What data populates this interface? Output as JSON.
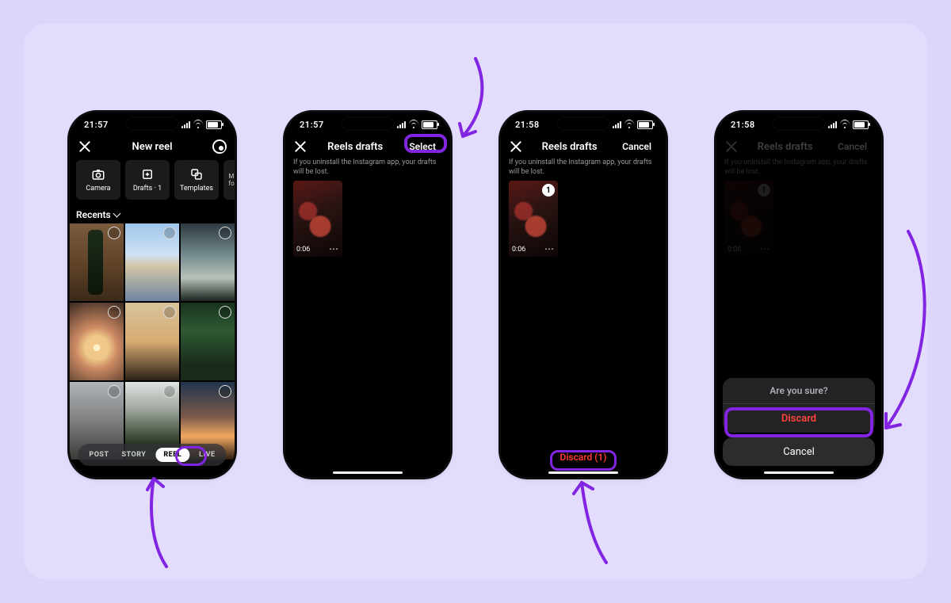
{
  "status": {
    "time1": "21:57",
    "time2": "21:57",
    "time3": "21:58",
    "time4": "21:58"
  },
  "phone1": {
    "title": "New reel",
    "tools": {
      "camera": "Camera",
      "drafts": "Drafts · 1",
      "templates": "Templates",
      "more": "M\nfo"
    },
    "recents": "Recents",
    "pill": {
      "post": "POST",
      "story": "STORY",
      "reel": "REEL",
      "live": "LIVE"
    }
  },
  "drafts": {
    "title": "Reels drafts",
    "select": "Select",
    "cancel": "Cancel",
    "info": "If you uninstall the Instagram app, your drafts will be lost.",
    "duration": "0:06",
    "selected_index": "1",
    "discard": "Discard (1)"
  },
  "sheet": {
    "title": "Are you sure?",
    "discard": "Discard",
    "cancel": "Cancel"
  }
}
